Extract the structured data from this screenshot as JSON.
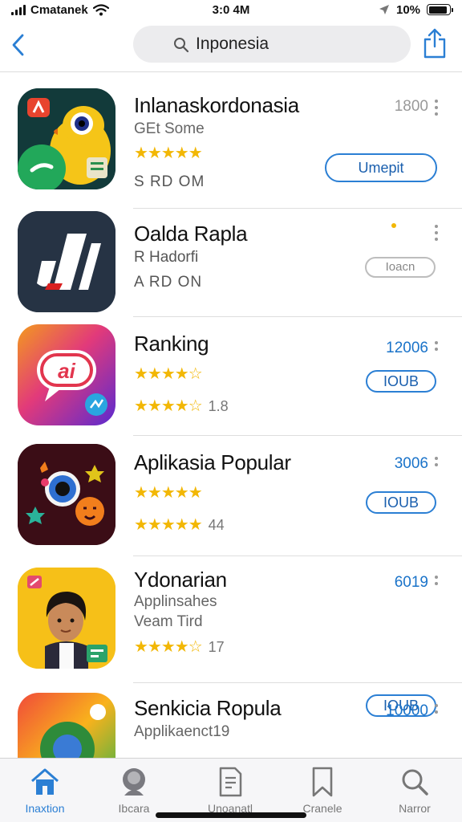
{
  "status_bar": {
    "carrier": "Cmatanek",
    "time": "3:0 4M",
    "battery": "10%",
    "battery_level": 0.9
  },
  "nav": {
    "search_text": "Inponesia",
    "icons": [
      "chevron-left-icon",
      "search-icon",
      "share-icon"
    ]
  },
  "apps": [
    {
      "name": "Inlanaskordonasia",
      "subtitle": "GEt Some",
      "stars": "★★★★★",
      "meta": "S RD OM",
      "count": "1800",
      "button": "Umepit",
      "colors": {
        "accent": "#2b7fd4"
      }
    },
    {
      "name": "Oalda Rapla",
      "subtitle": "R Hadorfi",
      "meta": "A RD ON",
      "count": "",
      "button": "Ioacn"
    },
    {
      "name": "Ranking",
      "stars": "★★★★☆",
      "stars2": "★★★★☆",
      "rating": "1.8",
      "count": "12006",
      "button": "IOUB"
    },
    {
      "name": "Aplikasia Popular",
      "stars": "★★★★★",
      "stars2": "★★★★★",
      "rating": "44",
      "count": "3006",
      "button": "IOUB"
    },
    {
      "name": "Ydonarian",
      "subtitle": "Applinsahes",
      "subtitle2": "Veam Tird",
      "stars": "★★★★☆",
      "rating": "17",
      "count": "6019",
      "button": "IOUB"
    },
    {
      "name": "Senkicia Ropula",
      "subtitle": "Applikaenct19",
      "count": "10000"
    }
  ],
  "tabs": [
    {
      "label": "Inaxtion",
      "icon": "home-icon",
      "active": true
    },
    {
      "label": "Ibcara",
      "icon": "person-icon",
      "active": false
    },
    {
      "label": "Unoanatl",
      "icon": "document-icon",
      "active": false
    },
    {
      "label": "Cranele",
      "icon": "bookmark-icon",
      "active": false
    },
    {
      "label": "Narror",
      "icon": "search-icon",
      "active": false
    }
  ],
  "colors": {
    "accent": "#2b7fd4",
    "star": "#f2b705",
    "tab_bg": "#f6f6f8"
  }
}
